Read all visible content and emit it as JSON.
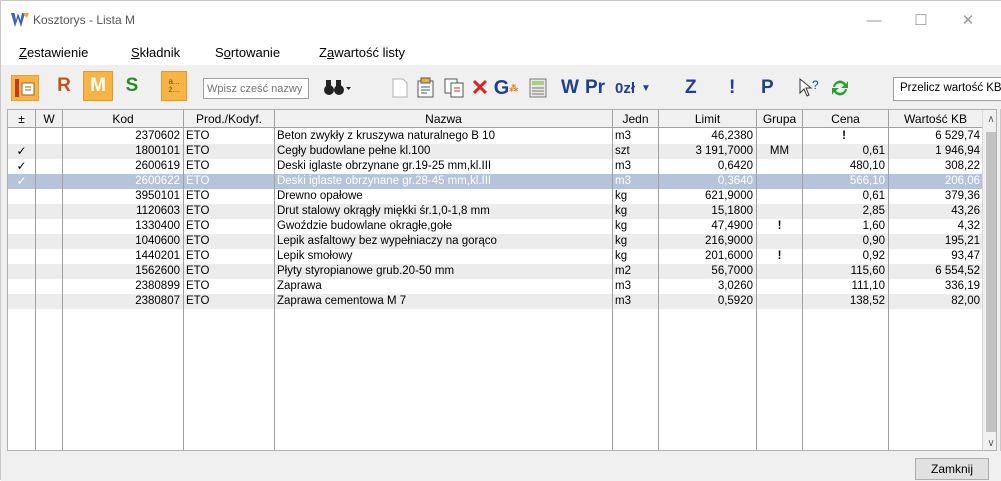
{
  "window": {
    "title": "Kosztorys  - Lista M",
    "min_symbol": "—",
    "max_symbol": "☐",
    "close_symbol": "✕"
  },
  "menu": [
    {
      "label_ul": "Z",
      "label_rest": "estawienie"
    },
    {
      "label_ul": "S",
      "label_rest": "kładnik"
    },
    {
      "label_pre": "S",
      "label_ul": "o",
      "label_rest": "rtowanie"
    },
    {
      "label_pre": "Z",
      "label_ul": "a",
      "label_rest": "wartość listy"
    }
  ],
  "toolbar": {
    "r_label": "R",
    "m_label": "M",
    "s_label": "S",
    "abc_label_1": "a...",
    "abc_label_2": "ż...",
    "search_placeholder": "Wpisz cześć nazwy",
    "w_label": "W",
    "pr_label": "Pr",
    "zl_label": "0zł",
    "z_label": "Z",
    "excl_label": "!",
    "p_label": "P",
    "recalc_label": "Przelicz wartość KB",
    "accent_orange": "#f7b445",
    "accent_blue": "#1f3f8f"
  },
  "grid": {
    "headers": [
      "±",
      "W",
      "Kod",
      "Prod./Kodyf.",
      "Nazwa",
      "Jedn",
      "Limit",
      "Grupa",
      "Cena",
      "Wartość KB"
    ],
    "rows": [
      {
        "pm": "",
        "w": "",
        "kod": "2370602",
        "prod": "ETO",
        "nazwa": "Beton zwykły z kruszywa naturalnego B 10",
        "jedn": "m3",
        "limit": "46,2380",
        "grupa": "",
        "cena": "!",
        "wart": "6 529,74"
      },
      {
        "pm": "✓",
        "w": "",
        "kod": "1800101",
        "prod": "ETO",
        "nazwa": "Cegły budowlane pełne kl.100",
        "jedn": "szt",
        "limit": "3 191,7000",
        "grupa": "MM",
        "cena": "0,61",
        "wart": "1 946,94"
      },
      {
        "pm": "✓",
        "w": "",
        "kod": "2600619",
        "prod": "ETO",
        "nazwa": "Deski iglaste obrzynane gr.19-25 mm,kl.III",
        "jedn": "m3",
        "limit": "0,6420",
        "grupa": "",
        "cena": "480,10",
        "wart": "308,22"
      },
      {
        "pm": "✓",
        "w": "",
        "kod": "2600622",
        "prod": "ETO",
        "nazwa": "Deski iglaste obrzynane gr.28-45 mm,kl.III",
        "jedn": "m3",
        "limit": "0,3640",
        "grupa": "",
        "cena": "566,10",
        "wart": "206,06"
      },
      {
        "pm": "",
        "w": "",
        "kod": "3950101",
        "prod": "ETO",
        "nazwa": "Drewno opałowe",
        "jedn": "kg",
        "limit": "621,9000",
        "grupa": "",
        "cena": "0,61",
        "wart": "379,36"
      },
      {
        "pm": "",
        "w": "",
        "kod": "1120603",
        "prod": "ETO",
        "nazwa": "Drut stalowy okrągły miękki śr.1,0-1,8 mm",
        "jedn": "kg",
        "limit": "15,1800",
        "grupa": "",
        "cena": "2,85",
        "wart": "43,26"
      },
      {
        "pm": "",
        "w": "",
        "kod": "1330400",
        "prod": "ETO",
        "nazwa": "Gwoździe budowlane okragłe,gołe",
        "jedn": "kg",
        "limit": "47,4900",
        "grupa": "!",
        "cena": "1,60",
        "wart": "4,32"
      },
      {
        "pm": "",
        "w": "",
        "kod": "1040600",
        "prod": "ETO",
        "nazwa": "Lepik asfaltowy bez wypełniaczy na gorąco",
        "jedn": "kg",
        "limit": "216,9000",
        "grupa": "",
        "cena": "0,90",
        "wart": "195,21"
      },
      {
        "pm": "",
        "w": "",
        "kod": "1440201",
        "prod": "ETO",
        "nazwa": "Lepik smołowy",
        "jedn": "kg",
        "limit": "201,6000",
        "grupa": "!",
        "cena": "0,92",
        "wart": "93,47"
      },
      {
        "pm": "",
        "w": "",
        "kod": "1562600",
        "prod": "ETO",
        "nazwa": "Płyty styropianowe grub.20-50 mm",
        "jedn": "m2",
        "limit": "56,7000",
        "grupa": "",
        "cena": "115,60",
        "wart": "6 554,52"
      },
      {
        "pm": "",
        "w": "",
        "kod": "2380899",
        "prod": "ETO",
        "nazwa": "Zaprawa",
        "jedn": "m3",
        "limit": "3,0260",
        "grupa": "",
        "cena": "111,10",
        "wart": "336,19"
      },
      {
        "pm": "",
        "w": "",
        "kod": "2380807",
        "prod": "ETO",
        "nazwa": "Zaprawa cementowa M 7",
        "jedn": "m3",
        "limit": "0,5920",
        "grupa": "",
        "cena": "138,52",
        "wart": "82,00"
      }
    ],
    "selected_row": 3,
    "selected_color": "#b5c3db"
  },
  "footer": {
    "close_label": "Zamknij"
  }
}
